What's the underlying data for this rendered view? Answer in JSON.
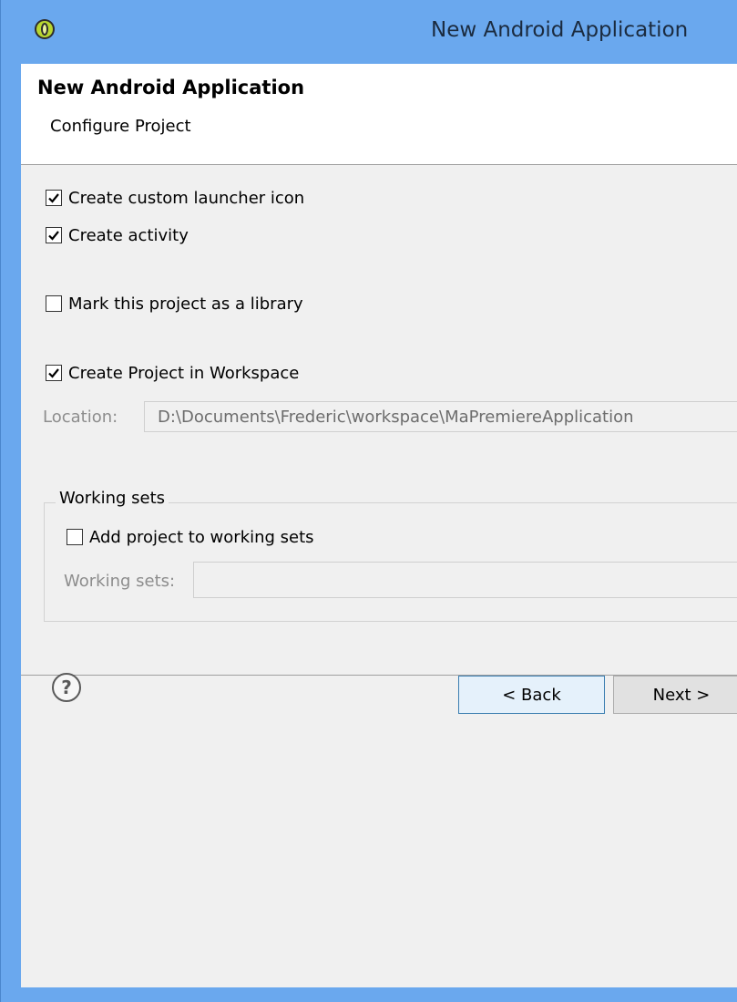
{
  "window": {
    "title": "New Android Application"
  },
  "banner": {
    "title": "New Android Application",
    "subtitle": "Configure Project"
  },
  "options": {
    "custom_launcher_icon": {
      "label": "Create custom launcher icon",
      "checked": true
    },
    "create_activity": {
      "label": "Create activity",
      "checked": true
    },
    "mark_library": {
      "label": "Mark this project as a library",
      "checked": false
    },
    "create_in_workspace": {
      "label": "Create Project in Workspace",
      "checked": true
    }
  },
  "location": {
    "label": "Location:",
    "value": "D:\\Documents\\Frederic\\workspace\\MaPremiereApplication"
  },
  "working_sets": {
    "group_title": "Working sets",
    "add_label": "Add project to working sets",
    "add_checked": false,
    "field_label": "Working sets:",
    "field_value": ""
  },
  "footer": {
    "back_label": "< Back",
    "next_label": "Next >"
  },
  "icons": {
    "app": "eclipse-adt-icon",
    "help": "help-question-icon",
    "check": "checkmark-icon"
  }
}
